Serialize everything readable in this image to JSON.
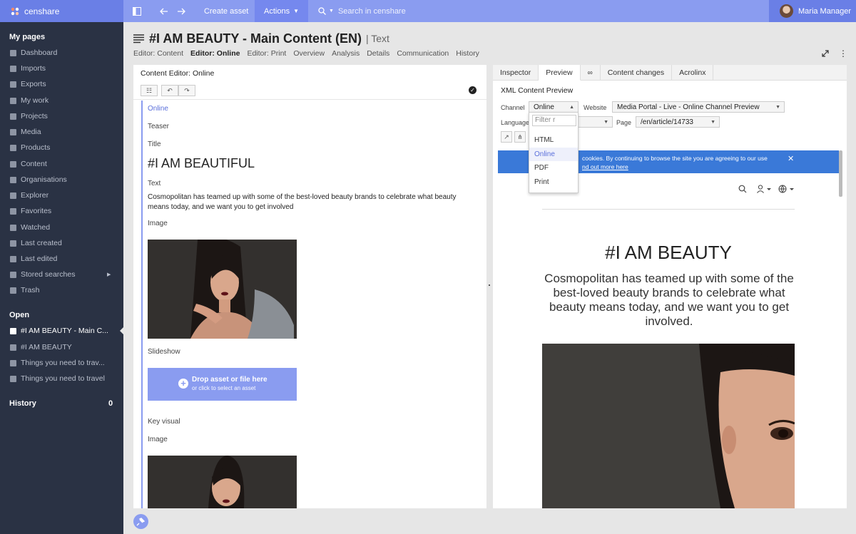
{
  "app": {
    "name": "censhare"
  },
  "topbar": {
    "create_asset": "Create asset",
    "actions": "Actions",
    "search_placeholder": "Search in censhare",
    "user_name": "Maria Manager"
  },
  "sidebar": {
    "my_pages_title": "My pages",
    "items": [
      {
        "label": "Dashboard",
        "icon": "home-icon"
      },
      {
        "label": "Imports",
        "icon": "import-icon"
      },
      {
        "label": "Exports",
        "icon": "export-icon"
      },
      {
        "label": "My work",
        "icon": "check-icon"
      },
      {
        "label": "Projects",
        "icon": "projects-icon"
      },
      {
        "label": "Media",
        "icon": "media-icon"
      },
      {
        "label": "Products",
        "icon": "products-icon"
      },
      {
        "label": "Content",
        "icon": "content-icon"
      },
      {
        "label": "Organisations",
        "icon": "organisations-icon"
      },
      {
        "label": "Explorer",
        "icon": "explorer-icon"
      },
      {
        "label": "Favorites",
        "icon": "heart-icon"
      },
      {
        "label": "Watched",
        "icon": "eye-icon"
      },
      {
        "label": "Last created",
        "icon": "last-created-icon"
      },
      {
        "label": "Last edited",
        "icon": "last-edited-icon"
      },
      {
        "label": "Stored searches",
        "icon": "search-icon"
      },
      {
        "label": "Trash",
        "icon": "trash-icon"
      }
    ],
    "open_title": "Open",
    "open_items": [
      {
        "label": "#I AM BEAUTY - Main C..."
      },
      {
        "label": "#I AM BEAUTY"
      },
      {
        "label": "Things you need to trav..."
      },
      {
        "label": "Things you need to travel"
      }
    ],
    "history_title": "History",
    "history_count": "0"
  },
  "header": {
    "title": "#I AM BEAUTY - Main Content (EN)",
    "type": "| Text",
    "tabs": [
      "Editor: Content",
      "Editor: Online",
      "Editor: Print",
      "Overview",
      "Analysis",
      "Details",
      "Communication",
      "History"
    ],
    "active_tab": "Editor: Online"
  },
  "content_editor": {
    "title": "Content Editor: Online",
    "channel_label": "Online",
    "teaser_label": "Teaser",
    "title_label": "Title",
    "heading": "#I AM BEAUTIFUL",
    "text_label": "Text",
    "body": "Cosmopolitan has teamed up with some of the best-loved beauty brands to celebrate what beauty means today, and we want you to get involved",
    "image_label": "Image",
    "slideshow_label": "Slideshow",
    "drop_title": "Drop asset or file here",
    "drop_sub": "or click to select an asset",
    "key_visual_label": "Key visual",
    "image_label_2": "Image"
  },
  "right_panel": {
    "tabs": [
      "Inspector",
      "Preview",
      "",
      "Content changes",
      "Acrolinx"
    ],
    "active_tab": "Preview",
    "xml_title": "XML Content Preview",
    "channel_label": "Channel",
    "channel_value": "Online",
    "website_label": "Website",
    "website_value": "Media Portal - Live - Online Channel Preview",
    "language_label": "Language",
    "page_label": "Page",
    "page_value": "/en/article/14733",
    "dropdown": {
      "filter_placeholder": "Filter r",
      "options": [
        "HTML",
        "Online",
        "PDF",
        "Print"
      ],
      "selected": "Online"
    },
    "preview": {
      "cookie_text": "cookies. By continuing to browse the site you are agreeing to our use",
      "cookie_link": "nd out more here",
      "heading": "#I AM BEAUTY",
      "body": "Cosmopolitan has teamed up with some of the best-loved beauty brands to celebrate what beauty means today, and we want you to get involved."
    }
  },
  "colors": {
    "accent": "#8a9cf0",
    "sidebar": "#2a3244",
    "cookie_bar": "#3a79d8"
  }
}
